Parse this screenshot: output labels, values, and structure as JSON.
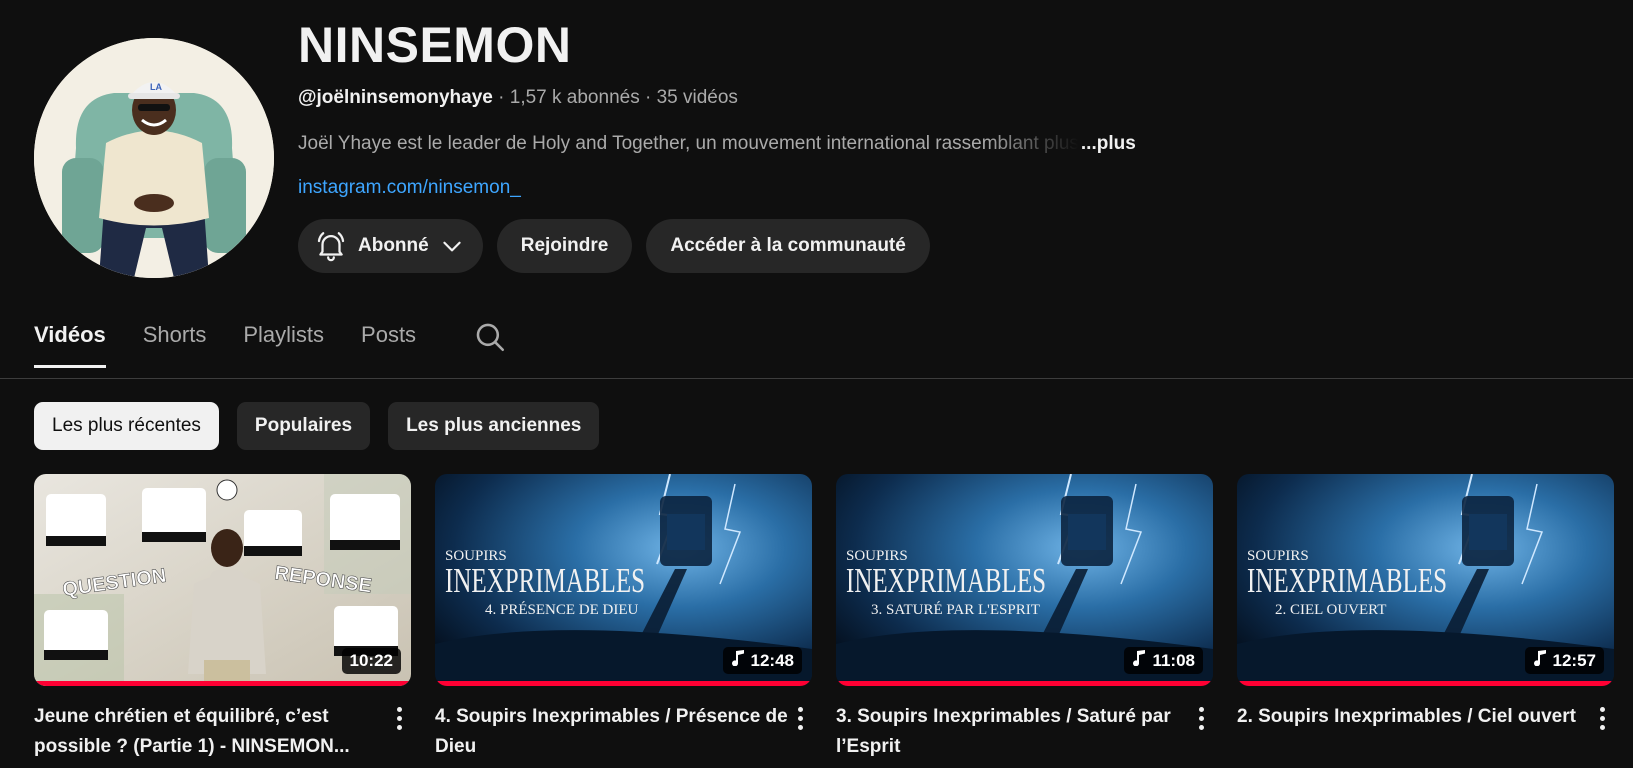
{
  "channel": {
    "name": "NINSEMON",
    "handle": "@joëlninsemonyhaye",
    "stats": "· 1,57 k abonnés · 35 vidéos",
    "description": "Joël Yhaye est le leader de Holy and Together, un mouvement international rassemblant plus",
    "more_label": "...plus",
    "link": "instagram.com/ninsemon_"
  },
  "actions": {
    "subscribed_label": "Abonné",
    "join_label": "Rejoindre",
    "community_label": "Accéder à la communauté"
  },
  "tabs": [
    "Vidéos",
    "Shorts",
    "Playlists",
    "Posts"
  ],
  "active_tab": "Vidéos",
  "chips": [
    "Les plus récentes",
    "Populaires",
    "Les plus anciennes"
  ],
  "selected_chip": "Les plus récentes",
  "thumbnail_texts": {
    "question": "QUESTION",
    "reponse": "REPONSE",
    "series_small": "SOUPIRS",
    "series_big": "INEXPRIMABLES"
  },
  "videos": [
    {
      "title": "Jeune chrétien et équilibré, c’est possible ? (Partie 1) - NINSEMON...",
      "duration": "10:22",
      "has_music_icon": false,
      "progress": 1.0,
      "thumb_style": "qa"
    },
    {
      "title": "4. Soupirs Inexprimables / Présence de Dieu",
      "duration": "12:48",
      "has_music_icon": true,
      "progress": 1.0,
      "thumb_style": "storm",
      "episode_label": "4.   PRÉSENCE DE DIEU"
    },
    {
      "title": "3. Soupirs Inexprimables / Saturé par l’Esprit",
      "duration": "11:08",
      "has_music_icon": true,
      "progress": 1.0,
      "thumb_style": "storm",
      "episode_label": "3.   SATURÉ PAR L'ESPRIT"
    },
    {
      "title": "2. Soupirs Inexprimables / Ciel ouvert",
      "duration": "12:57",
      "has_music_icon": true,
      "progress": 1.0,
      "thumb_style": "storm",
      "episode_label": "2.   CIEL OUVERT"
    }
  ],
  "colors": {
    "background": "#0f0f0f",
    "pill": "#272727",
    "link": "#3ea6ff",
    "progress": "#ff0033",
    "text_primary": "#f1f1f1",
    "text_secondary": "#aaaaaa"
  }
}
